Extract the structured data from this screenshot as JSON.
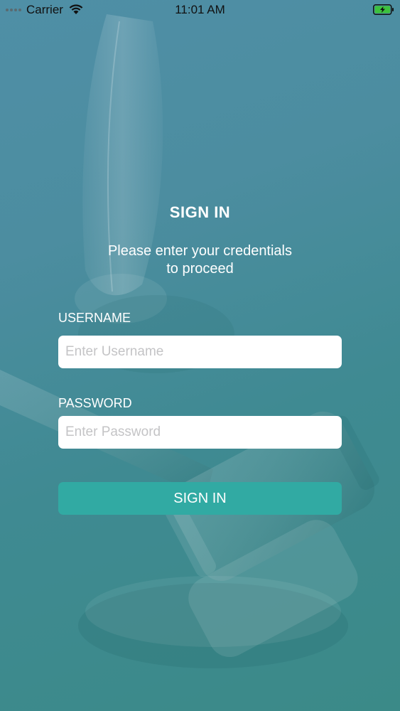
{
  "status_bar": {
    "carrier": "Carrier",
    "time": "11:01 AM",
    "wifi_icon": "wifi-icon",
    "battery_icon": "battery-charging-icon",
    "battery_color": "#3cc23c"
  },
  "sign_in": {
    "title": "SIGN IN",
    "subtitle_line1": "Please enter your credentials",
    "subtitle_line2": "to proceed",
    "username_label": "USERNAME",
    "username_placeholder": "Enter Username",
    "username_value": "",
    "password_label": "PASSWORD",
    "password_placeholder": "Enter Password",
    "password_value": "",
    "button_label": "SIGN IN",
    "button_color": "#31aaa3"
  },
  "background": {
    "image": "feather-and-gavel"
  }
}
